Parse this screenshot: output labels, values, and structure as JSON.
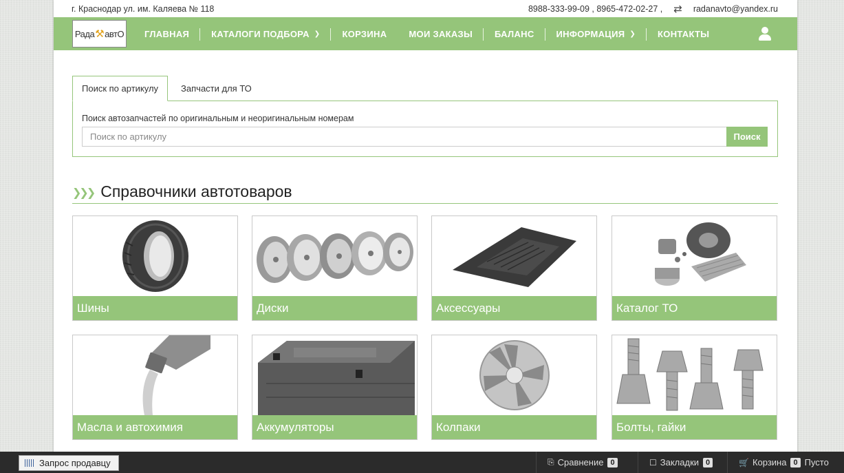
{
  "topbar": {
    "address": "г. Краснодар ул. им. Каляева № 118",
    "phones": "8988-333-99-09 , 8965-472-02-27 ,",
    "email": "radanavto@yandex.ru"
  },
  "logo": {
    "left": "Рада",
    "right": "авт",
    "end": "О"
  },
  "nav": [
    {
      "label": "Главная"
    },
    {
      "label": "Каталоги подбора"
    },
    {
      "label": "Корзина"
    },
    {
      "label": "Мои заказы"
    },
    {
      "label": "Баланс"
    },
    {
      "label": "Информация"
    },
    {
      "label": "Контакты"
    }
  ],
  "search": {
    "tab_active": "Поиск по артикулу",
    "tab_inactive": "Запчасти для ТО",
    "description": "Поиск автозапчастей по оригинальным и неоригинальным номерам",
    "placeholder": "Поиск по артикулу",
    "value": "",
    "button": "Поиск"
  },
  "section": {
    "title": "Справочники автотоваров"
  },
  "cards": [
    {
      "label": "Шины",
      "icon": "tire-icon"
    },
    {
      "label": "Диски",
      "icon": "wheel-rims-icon"
    },
    {
      "label": "Аксессуары",
      "icon": "car-mat-icon"
    },
    {
      "label": "Каталог ТО",
      "icon": "maintenance-parts-icon"
    },
    {
      "label": "Масла и автохимия",
      "icon": "oil-bottle-icon"
    },
    {
      "label": "Аккумуляторы",
      "icon": "battery-icon"
    },
    {
      "label": "Колпаки",
      "icon": "hubcap-icon"
    },
    {
      "label": "Болты, гайки",
      "icon": "bolts-icon"
    }
  ],
  "bottombar": {
    "request_seller": "Запрос продавцу",
    "compare_label": "Сравнение",
    "compare_count": "0",
    "bookmarks_label": "Закладки",
    "bookmarks_count": "0",
    "cart_label": "Корзина",
    "cart_count": "0",
    "cart_status": "Пусто"
  },
  "colors": {
    "accent": "#95c57a",
    "bottombar": "#2b2b2b"
  }
}
